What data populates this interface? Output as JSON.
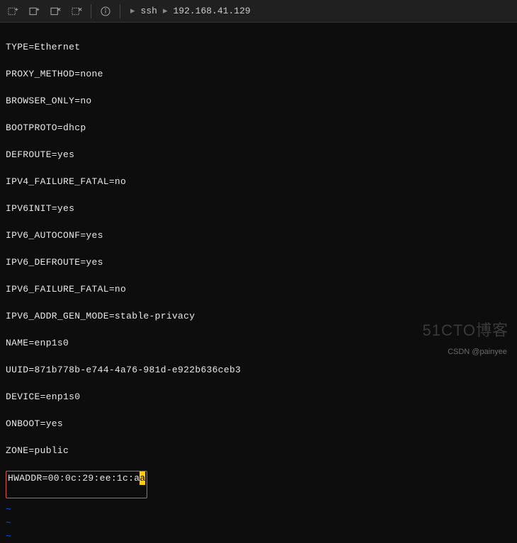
{
  "toolbar": {
    "icons": [
      "new-tab-icon",
      "new-tab-plus-icon",
      "close-tab-icon",
      "close-all-icon",
      "info-icon"
    ]
  },
  "breadcrumb": {
    "arrow": "▸",
    "item1": "ssh",
    "item2": "192.168.41.129"
  },
  "config_lines": [
    "TYPE=Ethernet",
    "PROXY_METHOD=none",
    "BROWSER_ONLY=no",
    "BOOTPROTO=dhcp",
    "DEFROUTE=yes",
    "IPV4_FAILURE_FATAL=no",
    "IPV6INIT=yes",
    "IPV6_AUTOCONF=yes",
    "IPV6_DEFROUTE=yes",
    "IPV6_FAILURE_FATAL=no",
    "IPV6_ADDR_GEN_MODE=stable-privacy",
    "NAME=enp1s0",
    "UUID=871b778b-e744-4a76-981d-e922b636ceb3",
    "DEVICE=enp1s0",
    "ONBOOT=yes",
    "ZONE=public"
  ],
  "highlighted_line": {
    "prefix": "HWADDR=00:0c:29:ee:1c:a",
    "cursor_char": "a"
  },
  "tilde": "~",
  "watermark": "51CTO博客",
  "credit": "CSDN @painyee"
}
